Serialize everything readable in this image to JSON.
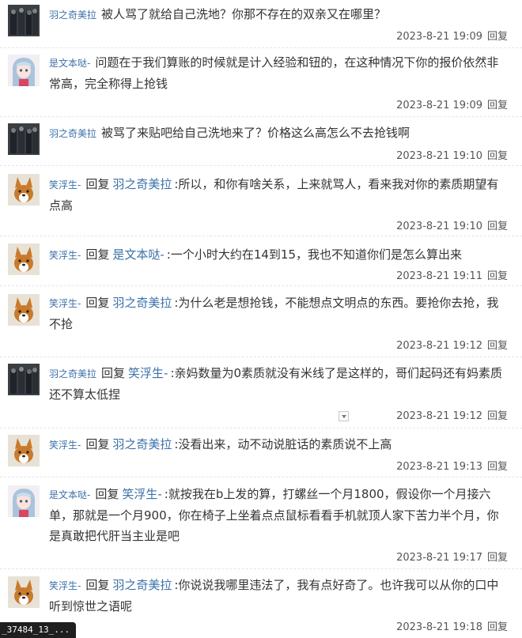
{
  "reply_link_label": "回复",
  "reply_word": "回复",
  "replies": [
    {
      "user": "羽之奇美拉",
      "avatar": "dark-group-avatar",
      "target": "",
      "text": "被人骂了就给自己洗地？你那不存在的双亲又在哪里？",
      "time": "2023-8-21 19:09"
    },
    {
      "user": "是文本哒-",
      "avatar": "anime-girl-avatar",
      "target": "",
      "text": "问题在于我们算账的时候就是计入经验和钮的，在这种情况下你的报价依然非常高，完全称得上抢钱",
      "time": "2023-8-21 19:09"
    },
    {
      "user": "羽之奇美拉",
      "avatar": "dark-group-avatar",
      "target": "",
      "text": "被骂了来贴吧给自己洗地来了？价格这么高怎么不去抢钱啊",
      "time": "2023-8-21 19:10"
    },
    {
      "user": "笑浮生-",
      "avatar": "corgi-avatar",
      "target": "羽之奇美拉",
      "text": ":所以，和你有啥关系，上来就骂人，看来我对你的素质期望有点高",
      "time": "2023-8-21 19:10"
    },
    {
      "user": "笑浮生-",
      "avatar": "corgi-avatar",
      "target": "是文本哒-",
      "text": ":一个小时大约在14到15，我也不知道你们是怎么算出来",
      "time": "2023-8-21 19:11"
    },
    {
      "user": "笑浮生-",
      "avatar": "corgi-avatar",
      "target": "羽之奇美拉",
      "text": ":为什么老是想抢钱，不能想点文明点的东西。要抢你去抢，我不抢",
      "time": "2023-8-21 19:12"
    },
    {
      "user": "羽之奇美拉",
      "avatar": "dark-group-avatar",
      "target": "笑浮生-",
      "text": ":亲妈数量为0素质就没有米线了是这样的，哥们起码还有妈素质还不算太低捏",
      "time": "2023-8-21 19:12"
    },
    {
      "user": "笑浮生-",
      "avatar": "corgi-avatar",
      "target": "羽之奇美拉",
      "text": ":没看出来，动不动说脏话的素质说不上高",
      "time": "2023-8-21 19:13"
    },
    {
      "user": "是文本哒-",
      "avatar": "anime-girl-avatar",
      "target": "笑浮生-",
      "text": ":就按我在b上发的算，打螺丝一个月1800，假设你一个月接六单，那就是一个月900，你在椅子上坐着点点鼠标看看手机就顶人家下苦力半个月，你是真敢把代肝当主业是吧",
      "time": "2023-8-21 19:17"
    },
    {
      "user": "笑浮生-",
      "avatar": "corgi-avatar",
      "target": "羽之奇美拉",
      "text": ":你说说我哪里违法了，我有点好奇了。也许我可以从你的口中听到惊世之语呢",
      "time": "2023-8-21 19:18"
    }
  ],
  "overlay_label": "_37484_13_..."
}
